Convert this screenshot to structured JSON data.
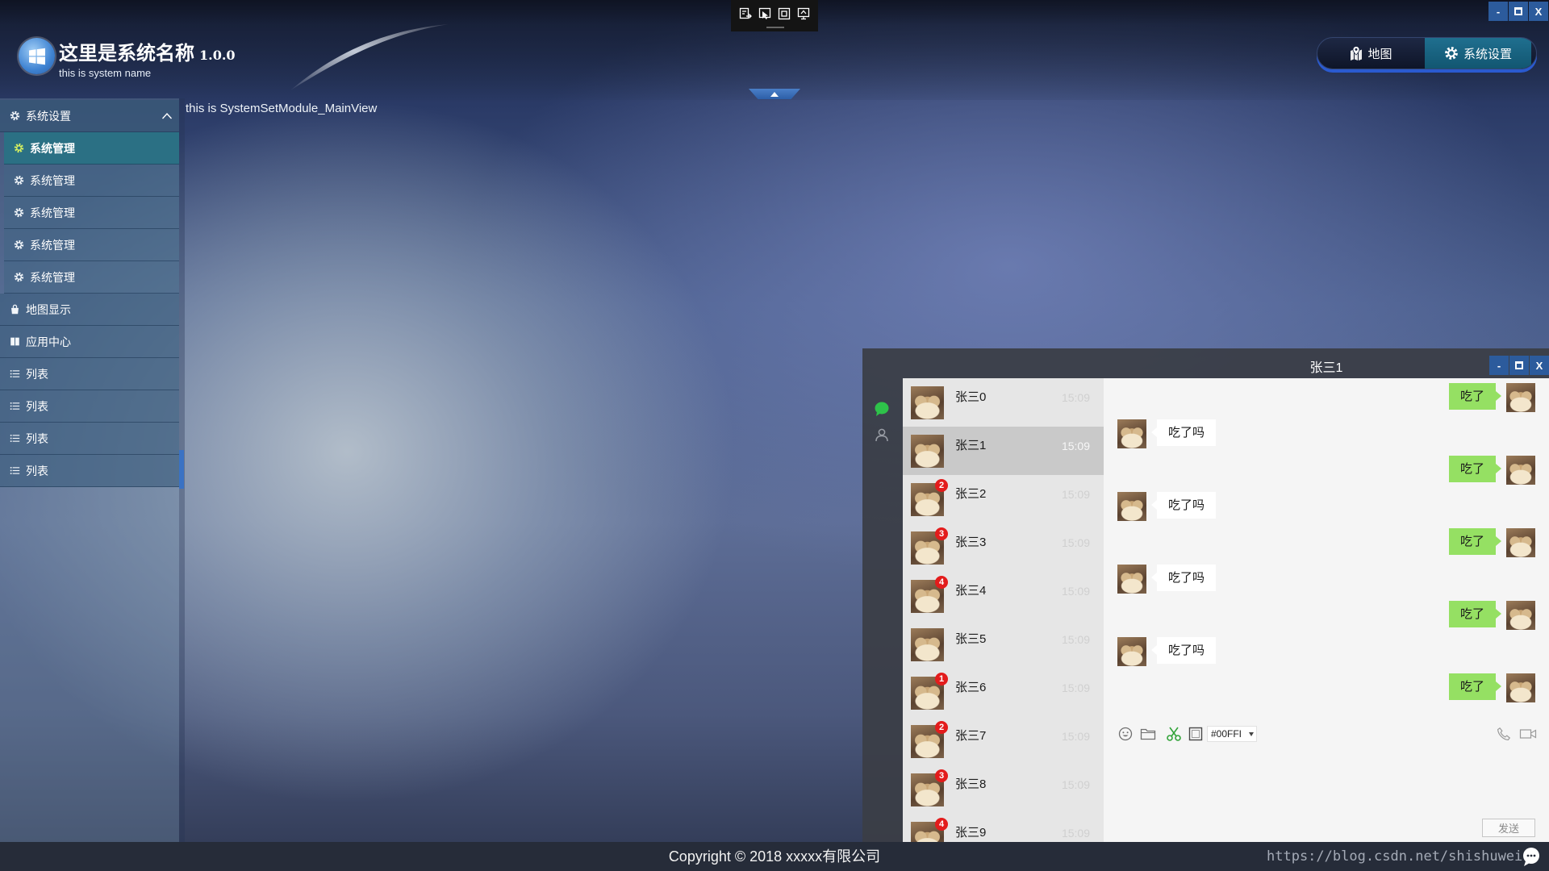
{
  "app": {
    "title": "这里是系统名称",
    "version": "1.0.0",
    "subtitle": "this is system name",
    "logo_icon": "windows-logo-icon"
  },
  "window_controls": {
    "minimize_label": "-",
    "close_label": "X"
  },
  "capture_toolbar": {
    "icons": [
      "export-icon",
      "pointer-select-icon",
      "fullscreen-icon",
      "screen-share-icon"
    ]
  },
  "top_nav": {
    "items": [
      {
        "label": "地图",
        "icon": "map-pin-icon",
        "active": false
      },
      {
        "label": "系统设置",
        "icon": "gear-icon",
        "active": true
      }
    ]
  },
  "sidebar": {
    "group": {
      "label": "系统设置",
      "icon": "gear-icon",
      "expanded": true,
      "items": [
        {
          "label": "系统管理",
          "icon": "gear-icon",
          "selected": true
        },
        {
          "label": "系统管理",
          "icon": "gear-icon",
          "selected": false
        },
        {
          "label": "系统管理",
          "icon": "gear-icon",
          "selected": false
        },
        {
          "label": "系统管理",
          "icon": "gear-icon",
          "selected": false
        },
        {
          "label": "系统管理",
          "icon": "gear-icon",
          "selected": false
        }
      ]
    },
    "items": [
      {
        "label": "地图显示",
        "icon": "bag-icon"
      },
      {
        "label": "应用中心",
        "icon": "book-icon"
      },
      {
        "label": "列表",
        "icon": "list-icon"
      },
      {
        "label": "列表",
        "icon": "list-icon"
      },
      {
        "label": "列表",
        "icon": "list-icon"
      },
      {
        "label": "列表",
        "icon": "list-icon"
      }
    ]
  },
  "main": {
    "view_text": "this is SystemSetModule_MainView"
  },
  "chat": {
    "title": "张三1",
    "side_icons": [
      "chat-bubble-icon",
      "contacts-icon"
    ],
    "contacts": [
      {
        "name": "张三0",
        "time": "15:09",
        "badge": null,
        "selected": false
      },
      {
        "name": "张三1",
        "time": "15:09",
        "badge": null,
        "selected": true
      },
      {
        "name": "张三2",
        "time": "15:09",
        "badge": 2,
        "selected": false
      },
      {
        "name": "张三3",
        "time": "15:09",
        "badge": 3,
        "selected": false
      },
      {
        "name": "张三4",
        "time": "15:09",
        "badge": 4,
        "selected": false
      },
      {
        "name": "张三5",
        "time": "15:09",
        "badge": null,
        "selected": false
      },
      {
        "name": "张三6",
        "time": "15:09",
        "badge": 1,
        "selected": false
      },
      {
        "name": "张三7",
        "time": "15:09",
        "badge": 2,
        "selected": false
      },
      {
        "name": "张三8",
        "time": "15:09",
        "badge": 3,
        "selected": false
      },
      {
        "name": "张三9",
        "time": "15:09",
        "badge": 4,
        "selected": false
      }
    ],
    "messages": [
      {
        "text": "吃了",
        "outgoing": true
      },
      {
        "text": "吃了吗",
        "outgoing": false
      },
      {
        "text": "吃了",
        "outgoing": true
      },
      {
        "text": "吃了吗",
        "outgoing": false
      },
      {
        "text": "吃了",
        "outgoing": true
      },
      {
        "text": "吃了吗",
        "outgoing": false
      },
      {
        "text": "吃了",
        "outgoing": true
      },
      {
        "text": "吃了吗",
        "outgoing": false
      },
      {
        "text": "吃了",
        "outgoing": true
      }
    ],
    "toolbar": {
      "icons": [
        "emoji-icon",
        "folder-icon",
        "scissors-icon",
        "image-icon"
      ],
      "color_value": "#00FFI",
      "call_icons": [
        "phone-icon",
        "video-icon"
      ]
    },
    "send_label": "发送"
  },
  "footer": {
    "copyright": "Copyright © 2018 xxxxx有限公司",
    "watermark": "https://blog.csdn.net/shishuwei",
    "watermark_icon": "chat-bubble-icon"
  },
  "colors": {
    "active_nav": "#1f6f8f",
    "selected_sidebar": "#2b7084",
    "window_control": "#2c5b9c",
    "bubble_outgoing": "#95e063",
    "bubble_incoming": "#ffffff",
    "badge": "#e31c1c",
    "contact_selected": "#c9c9c9"
  }
}
